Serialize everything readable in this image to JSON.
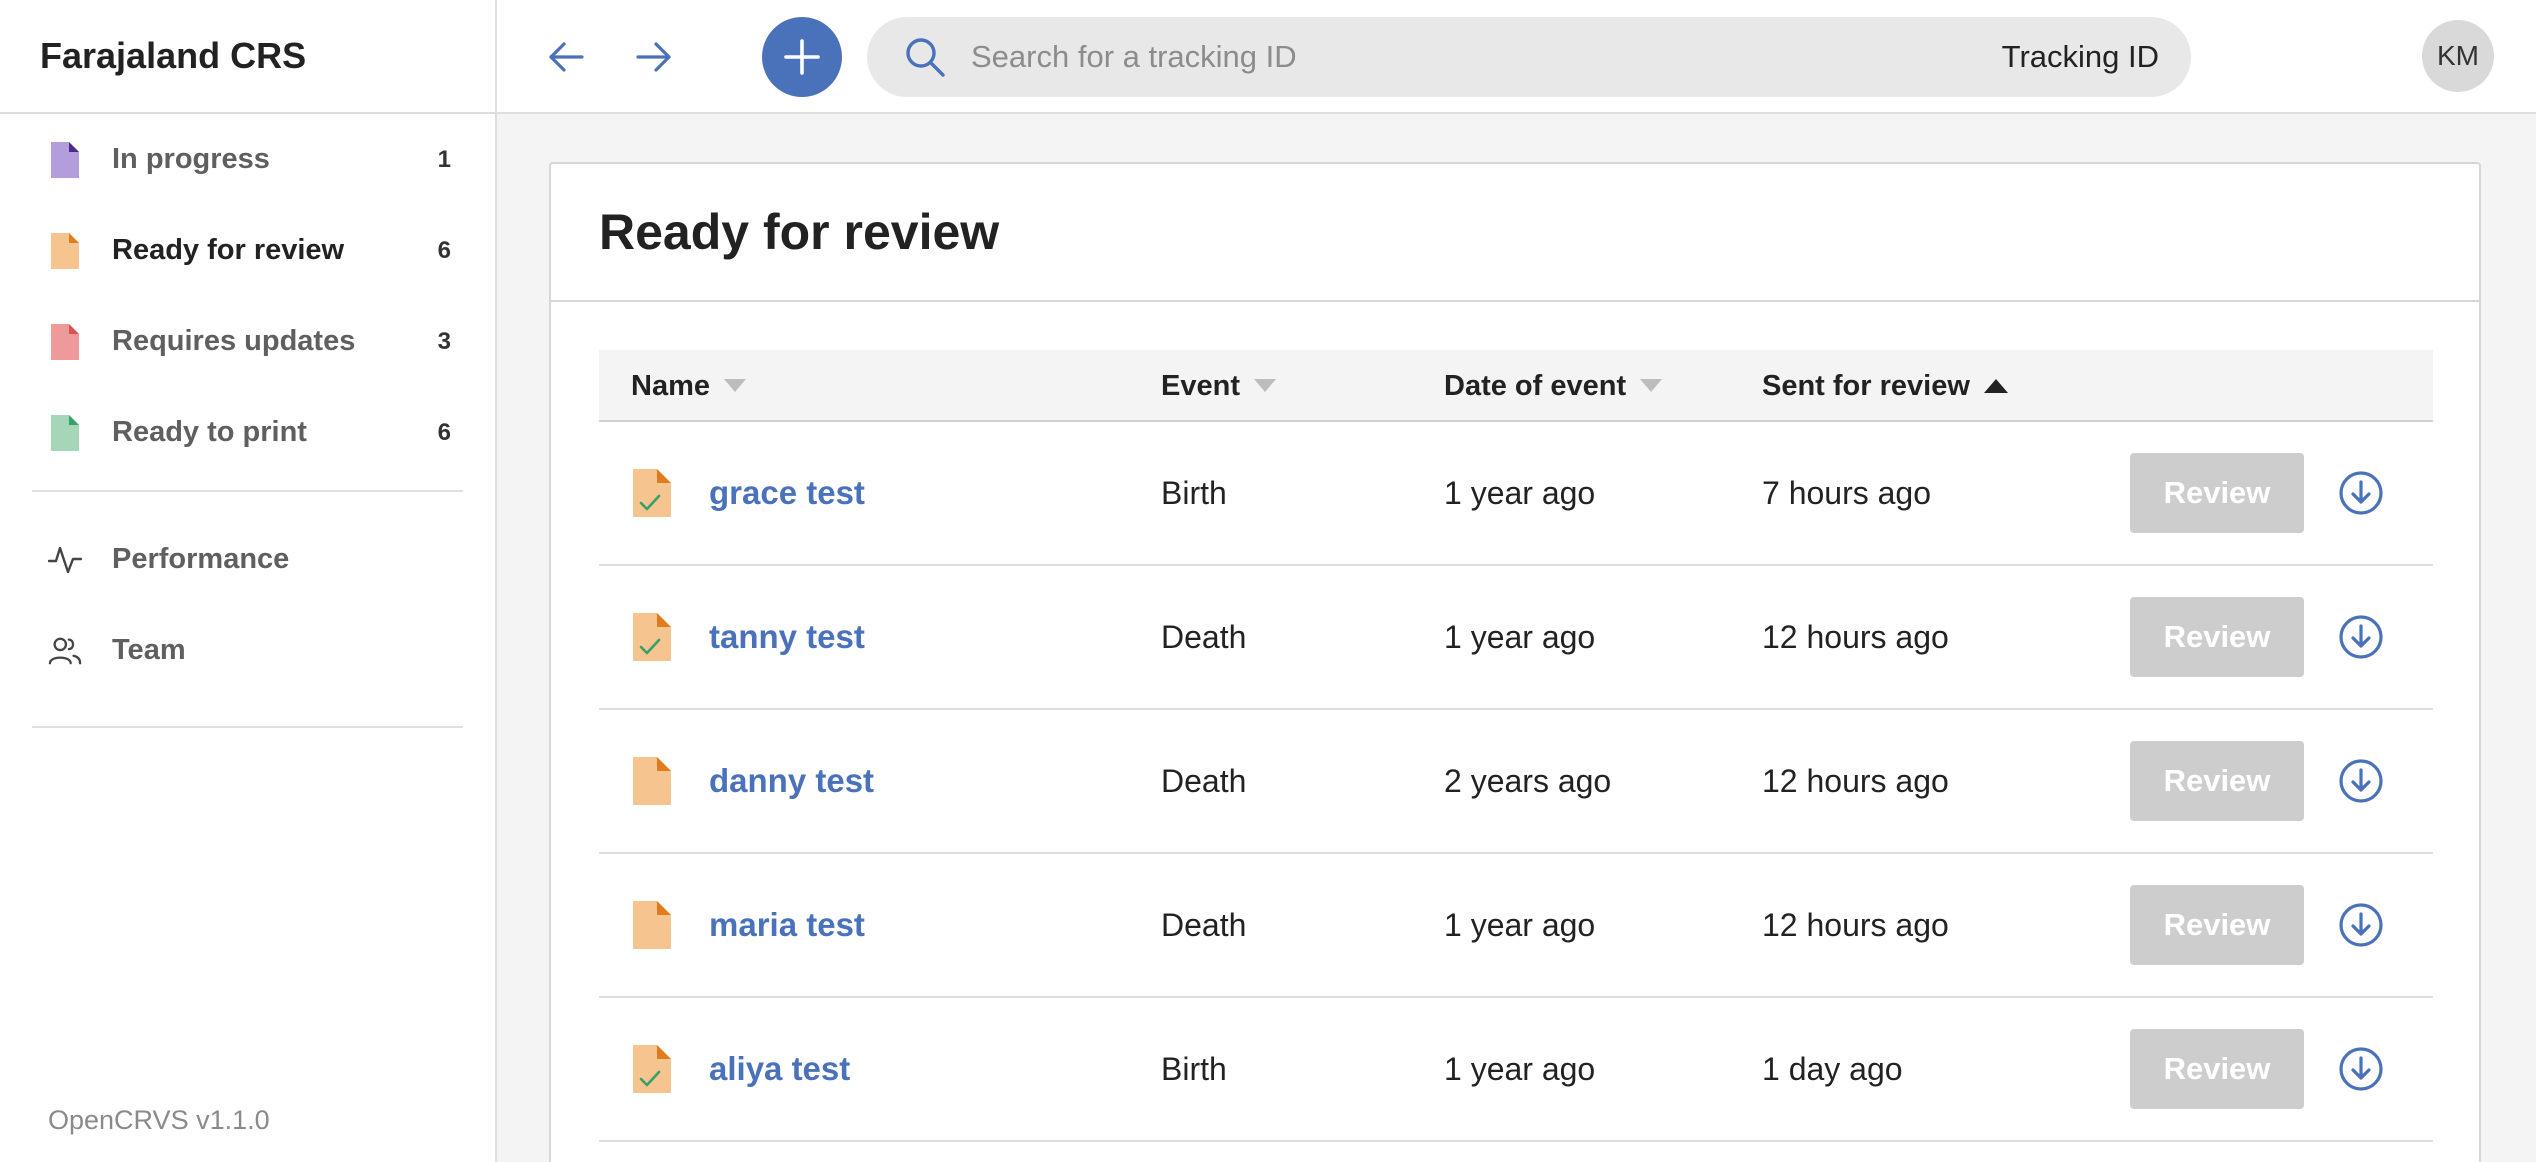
{
  "app": {
    "title": "Farajaland CRS",
    "version": "OpenCRVS v1.1.0"
  },
  "sidebar": {
    "workqueues": [
      {
        "label": "In progress",
        "count": "1",
        "icon": "document-purple-icon",
        "color": "#b39ddb"
      },
      {
        "label": "Ready for review",
        "count": "6",
        "icon": "document-orange-icon",
        "color": "#f5c48f"
      },
      {
        "label": "Requires updates",
        "count": "3",
        "icon": "document-red-icon",
        "color": "#ef9a9a"
      },
      {
        "label": "Ready to print",
        "count": "6",
        "icon": "document-green-icon",
        "color": "#a5d6b7"
      }
    ],
    "tools": [
      {
        "label": "Performance",
        "icon": "activity-icon"
      },
      {
        "label": "Team",
        "icon": "users-icon"
      }
    ]
  },
  "topbar": {
    "search": {
      "placeholder": "Search for a tracking ID",
      "value": "",
      "type_label": "Tracking ID"
    },
    "avatar_initials": "KM"
  },
  "main": {
    "title": "Ready for review",
    "columns": [
      "Name",
      "Event",
      "Date of event",
      "Sent for review"
    ],
    "sort_column": "Sent for review",
    "review_label": "Review",
    "rows": [
      {
        "name": "grace test",
        "event": "Birth",
        "date_of_event": "1 year ago",
        "sent_for_review": "7 hours ago",
        "validated": true
      },
      {
        "name": "tanny test",
        "event": "Death",
        "date_of_event": "1 year ago",
        "sent_for_review": "12 hours ago",
        "validated": true
      },
      {
        "name": "danny test",
        "event": "Death",
        "date_of_event": "2 years ago",
        "sent_for_review": "12 hours ago",
        "validated": false
      },
      {
        "name": "maria test",
        "event": "Death",
        "date_of_event": "1 year ago",
        "sent_for_review": "12 hours ago",
        "validated": false
      },
      {
        "name": "aliya test",
        "event": "Birth",
        "date_of_event": "1 year ago",
        "sent_for_review": "1 day ago",
        "validated": true
      }
    ]
  },
  "colors": {
    "primary": "#4972bb",
    "disabled_button": "#cdcdcd"
  }
}
